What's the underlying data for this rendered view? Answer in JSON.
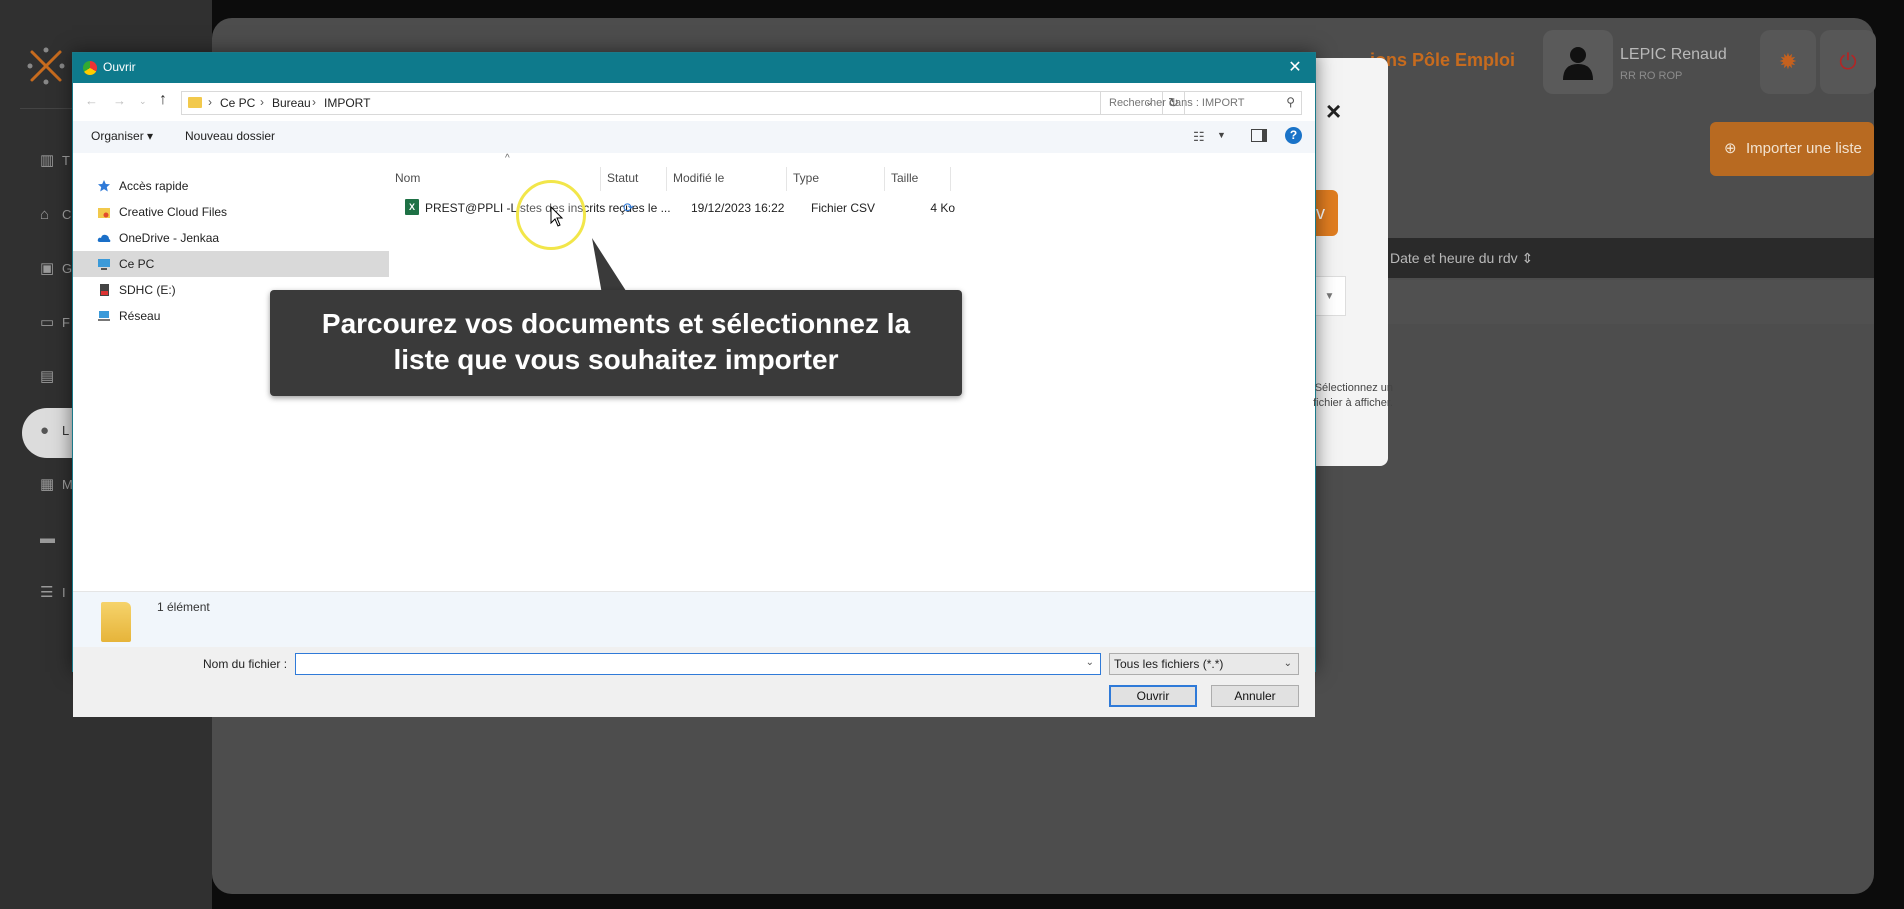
{
  "app": {
    "header_title": "ions Pôle Emploi",
    "user": {
      "name": "LEPIC Renaud",
      "role": "RR RO ROP"
    },
    "import_button": "Importer une liste",
    "table_header": "Date et heure du rdv ⇕",
    "sidebar_labels": [
      "T",
      "C",
      "G",
      "F",
      "",
      "L",
      "M",
      "",
      "I"
    ],
    "brand_color": "#e07d20"
  },
  "bg_modal": {
    "close": "×",
    "orange_label": "v"
  },
  "dialog": {
    "title": "Ouvrir",
    "close": "✕",
    "breadcrumbs": [
      "Ce PC",
      "Bureau",
      "IMPORT"
    ],
    "search_placeholder": "Rechercher dans : IMPORT",
    "toolbar": {
      "organize": "Organiser ▾",
      "new_folder": "Nouveau dossier"
    },
    "tree": [
      {
        "label": "Accès rapide",
        "icon": "star-icon"
      },
      {
        "label": "Creative Cloud Files",
        "icon": "cc-folder-icon"
      },
      {
        "label": "OneDrive - Jenkaa",
        "icon": "cloud-icon"
      },
      {
        "label": "Ce PC",
        "icon": "computer-icon"
      },
      {
        "label": "SDHC (E:)",
        "icon": "sd-card-icon"
      },
      {
        "label": "Réseau",
        "icon": "network-icon"
      }
    ],
    "columns": [
      "Nom",
      "Statut",
      "Modifié le",
      "Type",
      "Taille"
    ],
    "files": [
      {
        "name": "PREST@PPLI -Listes des inscrits reçues le ...",
        "modified": "19/12/2023 16:22",
        "type": "Fichier CSV",
        "size": "4 Ko"
      }
    ],
    "preview_text": "Sélectionnez un fichier à afficher.",
    "item_count": "1 élément",
    "filename_label": "Nom du fichier :",
    "filename_value": "",
    "filetype": "Tous les fichiers (*.*)",
    "open_label": "Ouvrir",
    "cancel_label": "Annuler"
  },
  "callout": {
    "line1": "Parcourez vos documents et sélectionnez la",
    "line2": "liste que vous souhaitez importer"
  }
}
